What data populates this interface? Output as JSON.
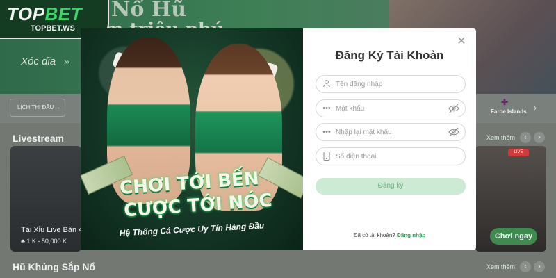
{
  "brand": {
    "name_main": "TOP",
    "name_accent": "BET",
    "url": "TOPBET.WS"
  },
  "hero": {
    "title": "Nổ Hũ",
    "subtitle": "m triệu phú",
    "promo_link": "Xóc đĩa"
  },
  "strip": {
    "schedule_label": "LỊCH THI ĐẤU →",
    "team_label": "Faroe Islands"
  },
  "sections": {
    "livestream": {
      "title": "Livestream",
      "more_label": "Xem thêm",
      "game_title": "Tài Xỉu Live Bàn 4",
      "game_range": "1 K - 50,000 K",
      "live_badge": "LIVE",
      "play_label": "Chơi ngay"
    },
    "jackpot": {
      "title": "Hũ Khủng Sắp Nổ",
      "more_label": "Xem thêm"
    }
  },
  "banner": {
    "line1": "CHƠI TỚI BẾN",
    "line2": "CƯỢC TỚI NÓC",
    "tagline": "Hệ Thống Cá Cược Uy Tín Hàng Đầu"
  },
  "register": {
    "title": "Đăng Ký Tài Khoản",
    "fields": {
      "username": "Tên đăng nhập",
      "password": "Mật khẩu",
      "confirm_password": "Nhập lại mật khẩu",
      "phone": "Số điện thoại"
    },
    "submit_label": "Đăng ký",
    "has_account": "Đã có tài khoản?",
    "login_label": "Đăng nhập"
  },
  "colors": {
    "brand_green": "#2f9a4d",
    "button_disabled": "#cdebd4"
  }
}
